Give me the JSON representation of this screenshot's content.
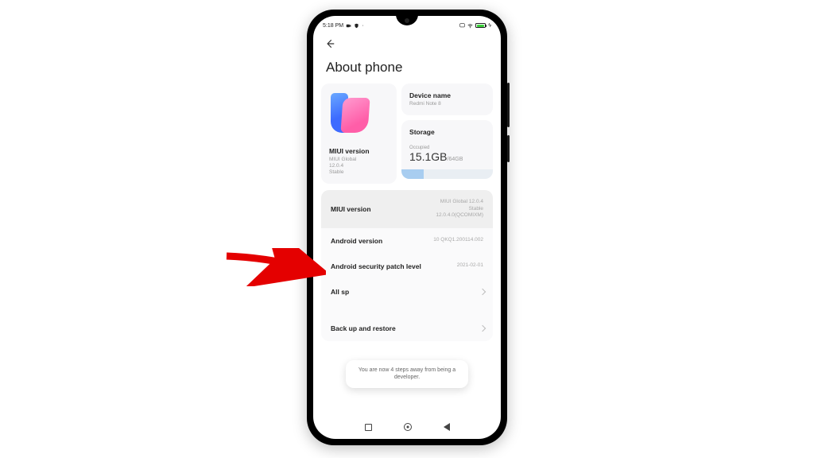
{
  "statusbar": {
    "time": "5:18 PM",
    "icons_left": [
      "camera-icon",
      "shield-icon",
      "more-icon"
    ],
    "icons_right": [
      "cast-icon",
      "wifi-icon",
      "battery-icon",
      "charging-icon"
    ]
  },
  "header": {
    "title": "About phone"
  },
  "miui_card": {
    "label": "MIUI version",
    "line1": "MIUI Global",
    "line2": "12.0.4",
    "line3": "Stable"
  },
  "device_card": {
    "label": "Device name",
    "value": "Redmi Note 8"
  },
  "storage_card": {
    "label": "Storage",
    "occupied_label": "Occupied",
    "used": "15.1GB",
    "total": "/64GB",
    "used_pct": 24
  },
  "rows": {
    "miui": {
      "label": "MIUI version",
      "line1": "MIUI Global 12.0.4",
      "line2": "Stable",
      "line3": "12.0.4.0(QCOMIXM)"
    },
    "android": {
      "label": "Android version",
      "value": "10 QKQ1.200114.002"
    },
    "patch": {
      "label": "Android security patch level",
      "value": "2021-02-01"
    },
    "allspecs": {
      "label": "All sp"
    },
    "backup": {
      "label": "Back up and restore"
    }
  },
  "toast": {
    "text": "You are now 4 steps away from being a developer."
  },
  "arrow": {
    "color": "#e40000"
  }
}
